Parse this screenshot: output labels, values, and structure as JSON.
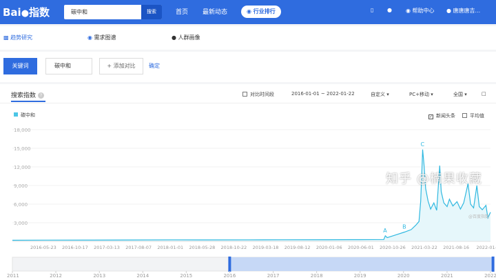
{
  "header": {
    "logo_text": "Bai",
    "logo_suffix": "指数",
    "search_value": "碳中和",
    "search_button": "搜索",
    "nav": [
      {
        "label": "首页"
      },
      {
        "label": "最新动态"
      }
    ],
    "nav_pill": "行业排行",
    "help": "帮助中心",
    "user": "唐唐唐吉..."
  },
  "subnav": {
    "items": [
      {
        "label": "趋势研究"
      },
      {
        "label": "需求图谱"
      },
      {
        "label": "人群画像"
      }
    ]
  },
  "keywords": {
    "button": "关键词",
    "keyword": "碳中和",
    "add": "+ 添加对比",
    "confirm": "确定"
  },
  "panel": {
    "tab": "搜索指数",
    "compare_period": "对比时间段",
    "date_range": "2016-01-01 ~ 2022-01-22",
    "custom": "自定义",
    "device": "PC+移动",
    "region": "全国",
    "news_label": "新闻头条",
    "avg_label": "平均值",
    "colors": {
      "line": "#2fb8e0",
      "fill": "#e6f7fb",
      "accent": "#2f6cdf"
    }
  },
  "chart_data": {
    "type": "area",
    "series": [
      {
        "name": "碳中和",
        "color": "#2fb8e0"
      }
    ],
    "ylim": [
      0,
      18000
    ],
    "yticks": [
      "3,000",
      "6,000",
      "9,000",
      "12,000",
      "15,000",
      "18,000"
    ],
    "xticks": [
      "2016-05-23",
      "2016-10-17",
      "2017-03-13",
      "2017-08-07",
      "2018-01-01",
      "2018-05-28",
      "2018-10-22",
      "2019-03-18",
      "2019-08-12",
      "2020-01-06",
      "2020-06-01",
      "2020-10-26",
      "2021-03-22",
      "2021-08-16",
      "2022-01-17"
    ],
    "points": [
      [
        "2016-01-01",
        180
      ],
      [
        "2016-06-01",
        200
      ],
      [
        "2017-01-01",
        210
      ],
      [
        "2017-06-01",
        220
      ],
      [
        "2018-01-01",
        240
      ],
      [
        "2018-06-01",
        230
      ],
      [
        "2019-01-01",
        250
      ],
      [
        "2019-06-01",
        260
      ],
      [
        "2020-01-01",
        270
      ],
      [
        "2020-06-01",
        280
      ],
      [
        "2020-09-15",
        300
      ],
      [
        "2020-09-22",
        900
      ],
      [
        "2020-10-01",
        600
      ],
      [
        "2020-11-15",
        1100
      ],
      [
        "2020-12-20",
        1500
      ],
      [
        "2021-01-20",
        1900
      ],
      [
        "2021-02-10",
        2600
      ],
      [
        "2021-02-25",
        3200
      ],
      [
        "2021-03-05",
        6500
      ],
      [
        "2021-03-10",
        11000
      ],
      [
        "2021-03-14",
        14800
      ],
      [
        "2021-03-20",
        12500
      ],
      [
        "2021-03-28",
        8500
      ],
      [
        "2021-04-08",
        6500
      ],
      [
        "2021-04-20",
        5200
      ],
      [
        "2021-05-05",
        6200
      ],
      [
        "2021-05-18",
        5000
      ],
      [
        "2021-06-01",
        12200
      ],
      [
        "2021-06-08",
        8000
      ],
      [
        "2021-06-20",
        6200
      ],
      [
        "2021-07-05",
        5600
      ],
      [
        "2021-07-16",
        6800
      ],
      [
        "2021-08-01",
        5700
      ],
      [
        "2021-08-20",
        6400
      ],
      [
        "2021-09-05",
        5200
      ],
      [
        "2021-09-20",
        6200
      ],
      [
        "2021-10-10",
        9300
      ],
      [
        "2021-10-22",
        6000
      ],
      [
        "2021-11-05",
        5400
      ],
      [
        "2021-11-20",
        9000
      ],
      [
        "2021-12-01",
        5600
      ],
      [
        "2021-12-15",
        5100
      ],
      [
        "2022-01-01",
        5800
      ],
      [
        "2022-01-10",
        3800
      ],
      [
        "2022-01-22",
        4700
      ]
    ],
    "annotations": [
      {
        "label": "A",
        "date": "2020-09-22",
        "value": 900
      },
      {
        "label": "B",
        "date": "2020-12-20",
        "value": 1500
      },
      {
        "label": "C",
        "date": "2021-03-14",
        "value": 14800
      }
    ],
    "source_note": "@百度指数",
    "range_years": [
      "2011",
      "2012",
      "2013",
      "2014",
      "2015",
      "2016",
      "2017",
      "2018",
      "2019",
      "2020",
      "2021",
      "2022"
    ],
    "selected_range": [
      "2016-01-01",
      "2022-01-22"
    ]
  },
  "watermark": "知乎 @楠果收藏"
}
